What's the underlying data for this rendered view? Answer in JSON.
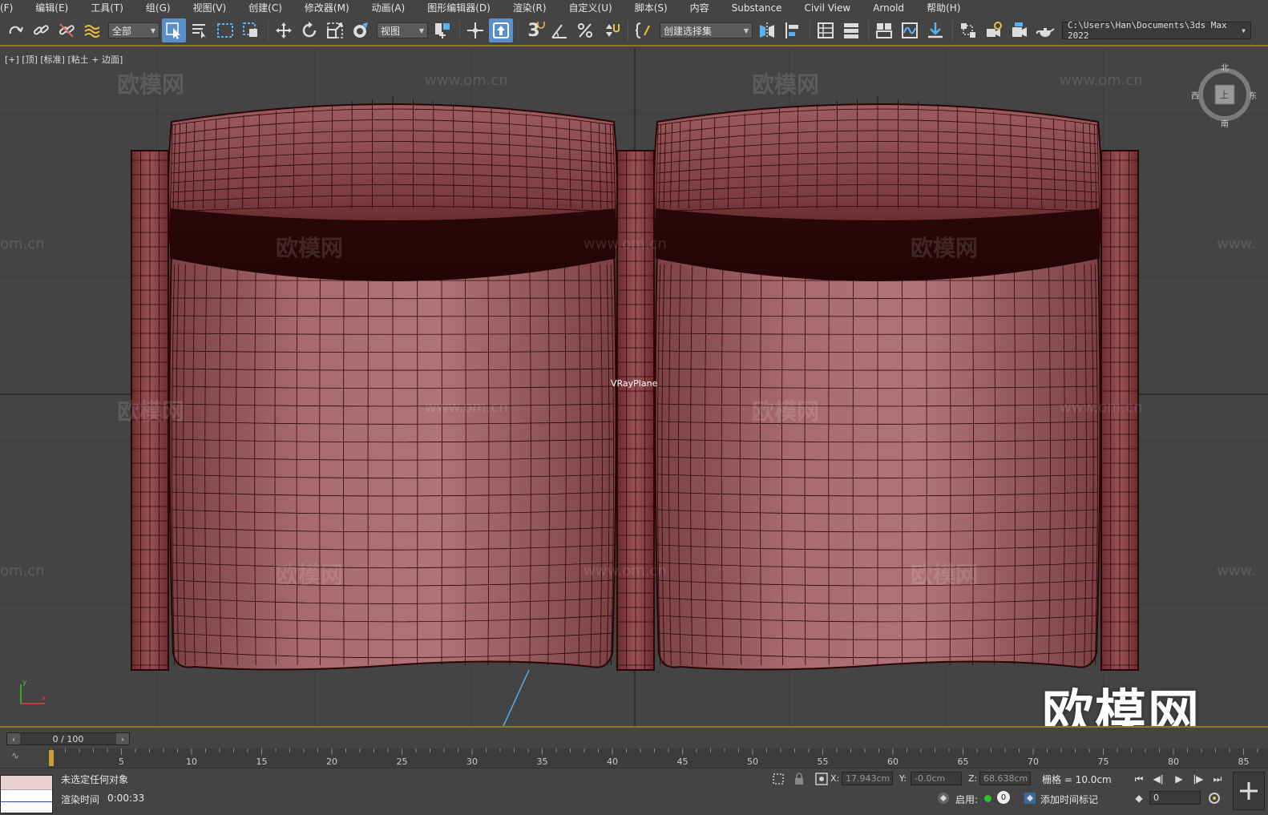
{
  "menu": [
    {
      "label": "(F)"
    },
    {
      "label": "编辑(E)"
    },
    {
      "label": "工具(T)"
    },
    {
      "label": "组(G)"
    },
    {
      "label": "视图(V)"
    },
    {
      "label": "创建(C)"
    },
    {
      "label": "修改器(M)"
    },
    {
      "label": "动画(A)"
    },
    {
      "label": "图形编辑器(D)"
    },
    {
      "label": "渲染(R)"
    },
    {
      "label": "自定义(U)"
    },
    {
      "label": "脚本(S)"
    },
    {
      "label": "内容"
    },
    {
      "label": "Substance"
    },
    {
      "label": "Civil View"
    },
    {
      "label": "Arnold"
    },
    {
      "label": "帮助(H)"
    }
  ],
  "toolbar": {
    "selection_filter": "全部",
    "coord_system": "视图",
    "named_selection": "创建选择集",
    "snap_label": "3",
    "project_path": "C:\\Users\\Han\\Documents\\3ds Max 2022"
  },
  "viewport": {
    "label": "[+] [顶] [标准] [粘土 + 边面]",
    "object_label": "VRayPlane",
    "watermark_cn": "欧模网",
    "watermark_url": "www.om.cn",
    "watermark_url_short": "om.cn",
    "watermark_url_cut": "www.",
    "logo": "欧模网",
    "viewcube_labels": {
      "north": "北",
      "south": "南",
      "east": "东",
      "west": "西",
      "face": "上"
    }
  },
  "timeline": {
    "frame_display": "0 / 100",
    "ticks": [
      "5",
      "10",
      "15",
      "20",
      "25",
      "30",
      "35",
      "40",
      "45",
      "50",
      "55",
      "60",
      "65",
      "70",
      "75",
      "80",
      "85"
    ]
  },
  "status": {
    "selection": "未选定任何对象",
    "render_time_label": "渲染时间",
    "render_time_value": "0:00:33",
    "x_label": "X:",
    "x_value": "17.943cm",
    "y_label": "Y:",
    "y_value": "-0.0cm",
    "z_label": "Z:",
    "z_value": "68.638cm",
    "grid_label": "栅格 = 10.0cm",
    "enable_label": "启用:",
    "enable_count": "0",
    "add_time_tag": "添加时间标记",
    "frame_field": "0"
  },
  "colors": {
    "accent": "#8c7a2a",
    "mesh_fill": "#a86a6e",
    "mesh_dark": "#3a0c0c",
    "wire": "#2a0606",
    "active_button": "#5b8fc9"
  }
}
